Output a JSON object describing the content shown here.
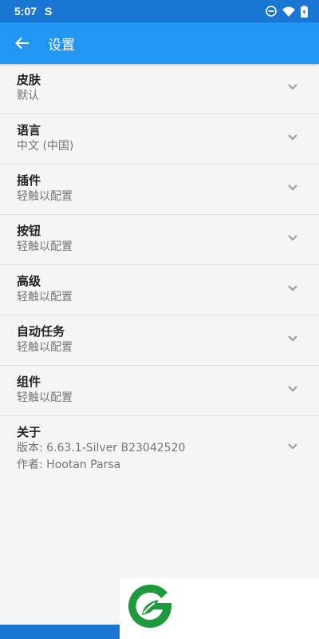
{
  "status_bar": {
    "time": "5:07",
    "app_icon_glyph": "S",
    "icons": [
      "dnd-icon",
      "wifi-icon",
      "battery-icon"
    ]
  },
  "app_bar": {
    "title": "设置",
    "back_icon": "arrow-left-icon"
  },
  "settings": {
    "items": [
      {
        "title": "皮肤",
        "subtitle": "默认"
      },
      {
        "title": "语言",
        "subtitle": "中文 (中国)"
      },
      {
        "title": "插件",
        "subtitle": "轻触以配置"
      },
      {
        "title": "按钮",
        "subtitle": "轻触以配置"
      },
      {
        "title": "高级",
        "subtitle": "轻触以配置"
      },
      {
        "title": "自动任务",
        "subtitle": "轻触以配置"
      },
      {
        "title": "组件",
        "subtitle": "轻触以配置"
      }
    ],
    "about": {
      "title": "关于",
      "version": "版本: 6.63.1-Silver  B23042520",
      "author": "作者: Hootan Parsa"
    }
  },
  "colors": {
    "status_bar": "#1976d2",
    "app_bar": "#2196f3",
    "background": "#f5f5f5",
    "logo_green": "#1e9a3c"
  },
  "watermark_logo": "green-leaf-logo"
}
